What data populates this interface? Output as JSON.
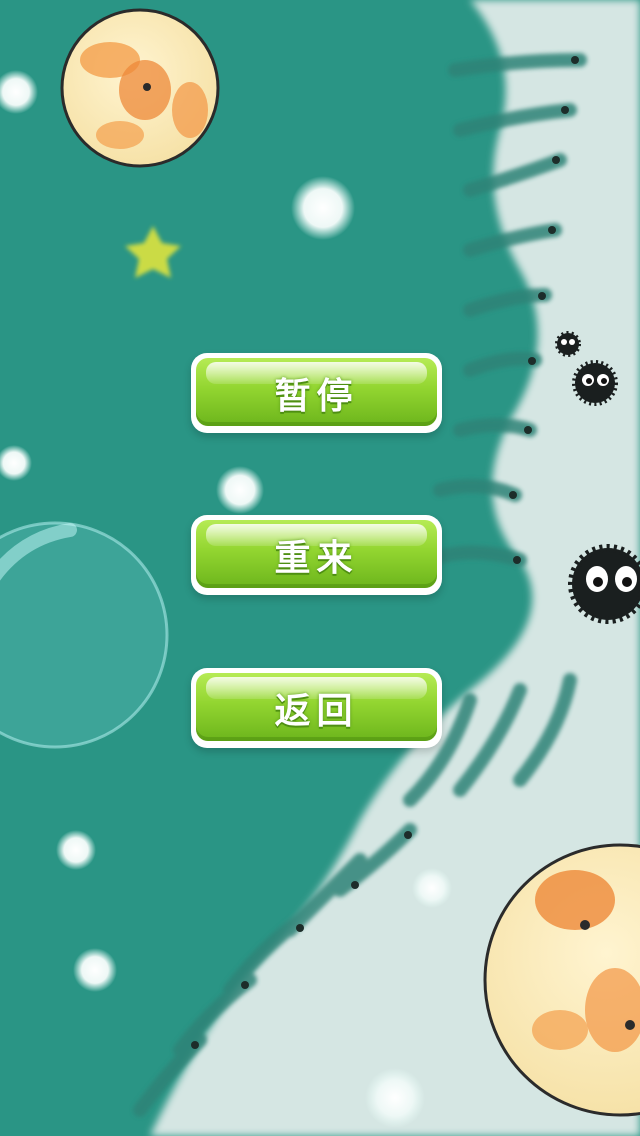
{
  "menu": {
    "pause_label": "暂停",
    "restart_label": "重来",
    "back_label": "返回"
  },
  "colors": {
    "background": "#2a9585",
    "button_green": "#92d530",
    "button_border": "#ffffff",
    "light_zone": "#d7e6e3"
  }
}
